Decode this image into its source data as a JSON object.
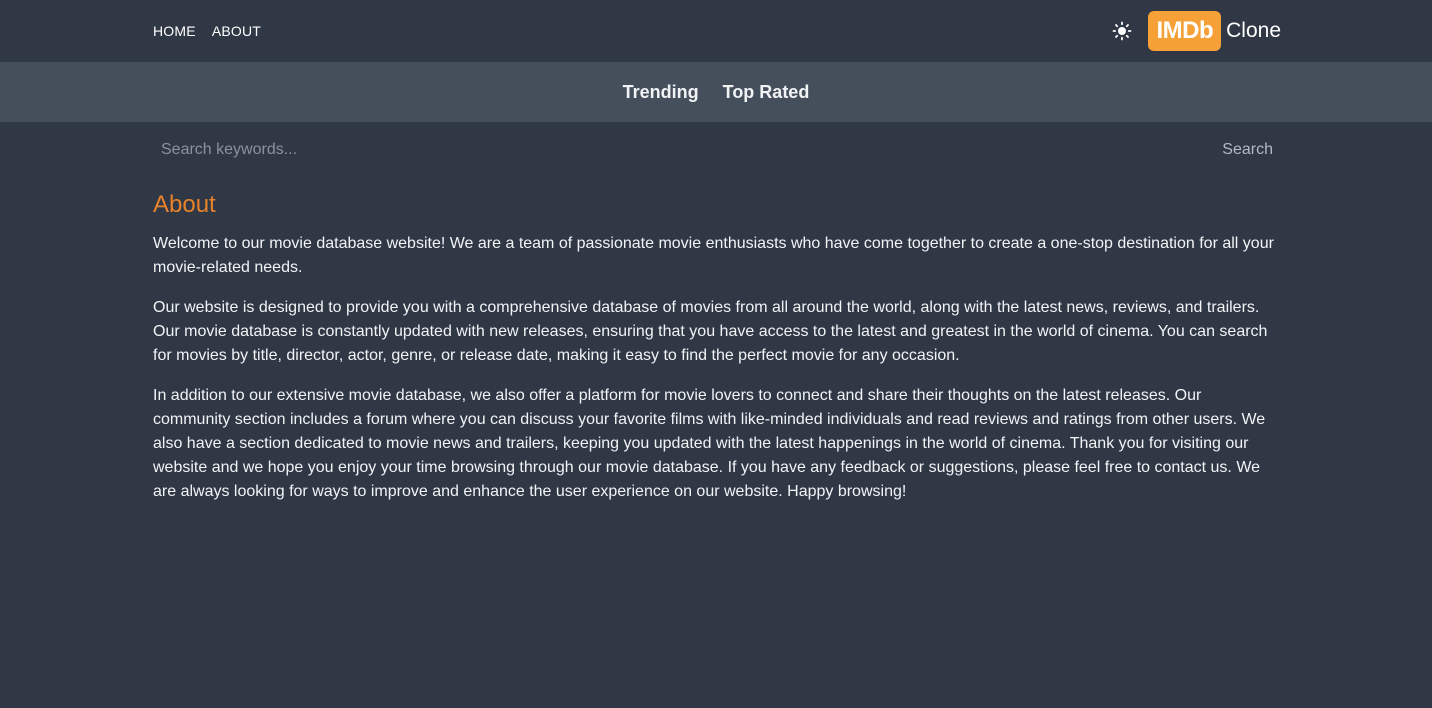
{
  "header": {
    "nav": [
      {
        "label": "HOME"
      },
      {
        "label": "ABOUT"
      }
    ],
    "theme_icon": "sun-icon",
    "logo": {
      "badge": "IMDb",
      "text": "Clone"
    }
  },
  "subnav": {
    "items": [
      {
        "label": "Trending"
      },
      {
        "label": "Top Rated"
      }
    ]
  },
  "search": {
    "value": "",
    "placeholder": "Search keywords...",
    "button_label": "Search"
  },
  "content": {
    "title": "About",
    "paragraphs": [
      "Welcome to our movie database website! We are a team of passionate movie enthusiasts who have come together to create a one-stop destination for all your movie-related needs.",
      "Our website is designed to provide you with a comprehensive database of movies from all around the world, along with the latest news, reviews, and trailers. Our movie database is constantly updated with new releases, ensuring that you have access to the latest and greatest in the world of cinema. You can search for movies by title, director, actor, genre, or release date, making it easy to find the perfect movie for any occasion.",
      "In addition to our extensive movie database, we also offer a platform for movie lovers to connect and share their thoughts on the latest releases. Our community section includes a forum where you can discuss your favorite films with like-minded individuals and read reviews and ratings from other users. We also have a section dedicated to movie news and trailers, keeping you updated with the latest happenings in the world of cinema. Thank you for visiting our website and we hope you enjoy your time browsing through our movie database. If you have any feedback or suggestions, please feel free to contact us. We are always looking for ways to improve and enhance the user experience on our website. Happy browsing!"
    ]
  },
  "colors": {
    "background": "#303846",
    "subnav_background": "#454f5c",
    "accent": "#e8822a",
    "logo_badge": "#f6a038"
  }
}
